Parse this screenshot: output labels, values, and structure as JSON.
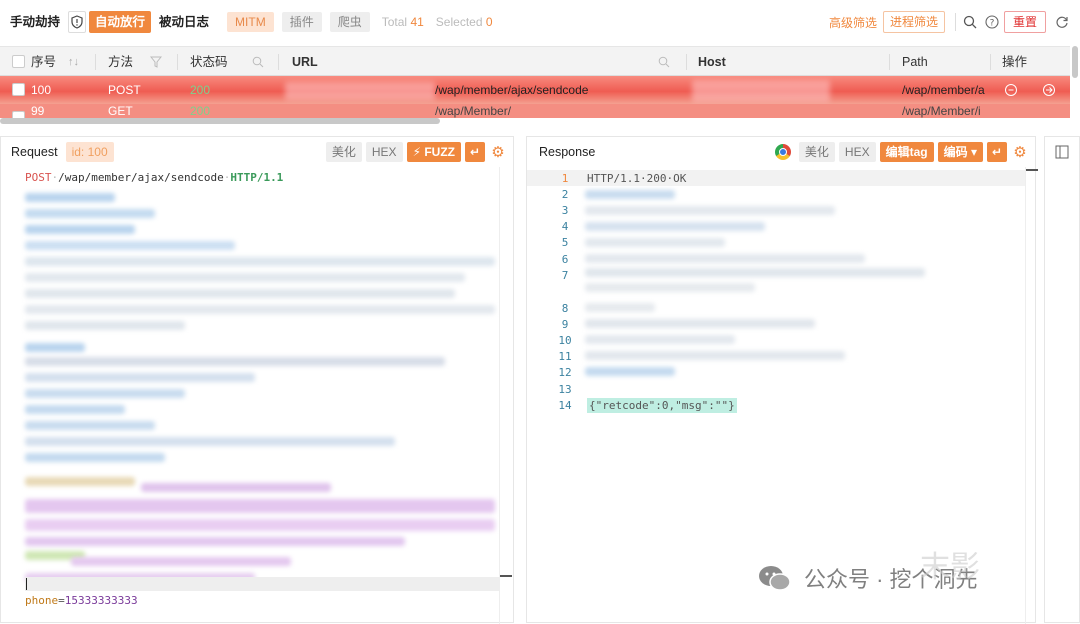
{
  "toolbar": {
    "manual": "手动劫持",
    "auto_release": "自动放行",
    "passive_log": "被动日志",
    "mitm": "MITM",
    "plugins": "插件",
    "crawler": "爬虫",
    "total_label": "Total",
    "total_value": "41",
    "selected_label": "Selected",
    "selected_value": "0",
    "advanced_filter": "高级筛选",
    "process_filter": "进程筛选",
    "reset": "重置"
  },
  "table": {
    "headers": {
      "index": "序号",
      "method": "方法",
      "status": "状态码",
      "url": "URL",
      "host": "Host",
      "path": "Path",
      "action": "操作"
    },
    "rows": [
      {
        "index": "100",
        "method": "POST",
        "status": "200",
        "url": "/wap/member/ajax/sendcode",
        "path": "/wap/member/a"
      },
      {
        "index": "99",
        "method": "GET",
        "status": "200",
        "url": "/wap/Member/",
        "path": "/wap/Member/i"
      }
    ]
  },
  "request": {
    "title": "Request",
    "id_label": "id:",
    "id_value": "100",
    "beautify": "美化",
    "hex": "HEX",
    "fuzz": "FUZZ",
    "first_line_method": "POST",
    "first_line_path": "/wap/member/ajax/sendcode",
    "first_line_proto": "HTTP/1.1",
    "body_key": "phone",
    "body_value": "15333333333"
  },
  "response": {
    "title": "Response",
    "beautify": "美化",
    "hex": "HEX",
    "edit_tag": "编辑tag",
    "encode": "编码",
    "status_line": "HTTP/1.1·200·OK",
    "line_numbers": [
      "1",
      "2",
      "3",
      "4",
      "5",
      "6",
      "7",
      "8",
      "9",
      "10",
      "11",
      "12",
      "13",
      "14"
    ],
    "body": "{\"retcode\":0,\"msg\":\"\"}"
  },
  "watermark": {
    "text": "公众号 · 挖个洞先",
    "brand": "末影"
  },
  "colors": {
    "accent": "#f0883e",
    "row_highlight": "#ef5c52",
    "status_ok": "#3aa55a"
  }
}
